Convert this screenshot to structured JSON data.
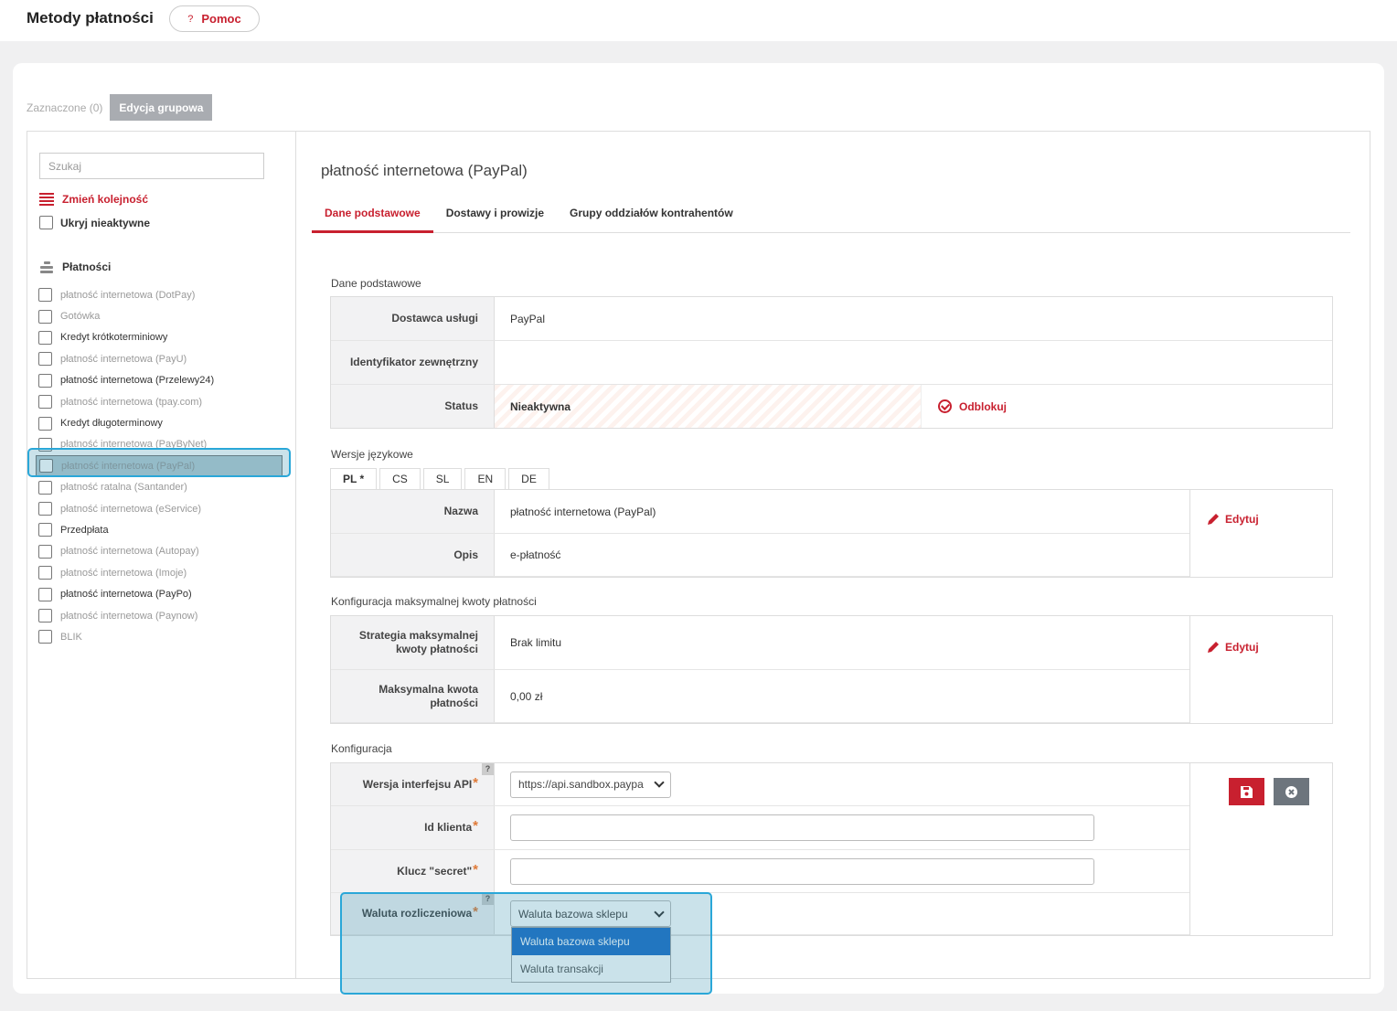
{
  "header": {
    "title": "Metody płatności",
    "help_label": "Pomoc",
    "help_icon": "?"
  },
  "bulk": {
    "selected_count": "Zaznaczone (0)",
    "group_edit_label": "Edycja grupowa"
  },
  "sidebar": {
    "search_placeholder": "Szukaj",
    "reorder_label": "Zmień kolejność",
    "hide_inactive_label": "Ukryj nieaktywne",
    "category_label": "Płatności",
    "items": [
      {
        "label": "płatność internetowa (DotPay)",
        "active": false
      },
      {
        "label": "Gotówka",
        "active": false
      },
      {
        "label": "Kredyt krótkoterminiowy",
        "active": true
      },
      {
        "label": "płatność internetowa (PayU)",
        "active": false
      },
      {
        "label": "płatność internetowa (Przelewy24)",
        "active": true
      },
      {
        "label": "płatność internetowa (tpay.com)",
        "active": false
      },
      {
        "label": "Kredyt długoterminowy",
        "active": true
      },
      {
        "label": "płatność internetowa (PayByNet)",
        "active": false
      },
      {
        "label": "płatność internetowa (PayPal)",
        "active": false,
        "selected": true
      },
      {
        "label": "płatność ratalna (Santander)",
        "active": false
      },
      {
        "label": "płatność internetowa (eService)",
        "active": false
      },
      {
        "label": "Przedpłata",
        "active": true
      },
      {
        "label": "płatność internetowa (Autopay)",
        "active": false
      },
      {
        "label": "płatność internetowa (Imoje)",
        "active": false
      },
      {
        "label": "płatność internetowa (PayPo)",
        "active": true
      },
      {
        "label": "płatność internetowa (Paynow)",
        "active": false
      },
      {
        "label": "BLIK",
        "active": false
      }
    ]
  },
  "detail": {
    "title": "płatność internetowa (PayPal)",
    "tabs": [
      "Dane podstawowe",
      "Dostawy i prowizje",
      "Grupy oddziałów kontrahentów"
    ],
    "basic": {
      "section": "Dane podstawowe",
      "provider_label": "Dostawca usługi",
      "provider_value": "PayPal",
      "external_id_label": "Identyfikator zewnętrzny",
      "external_id_value": "",
      "status_label": "Status",
      "status_value": "Nieaktywna",
      "unlock_label": "Odblokuj"
    },
    "lang": {
      "section": "Wersje językowe",
      "tabs": [
        "PL *",
        "CS",
        "SL",
        "EN",
        "DE"
      ],
      "name_label": "Nazwa",
      "name_value": "płatność internetowa (PayPal)",
      "desc_label": "Opis",
      "desc_value": "e-płatność",
      "edit_label": "Edytuj"
    },
    "limit": {
      "section": "Konfiguracja maksymalnej kwoty płatności",
      "strategy_label": "Strategia maksymalnej kwoty płatności",
      "strategy_value": "Brak limitu",
      "max_label": "Maksymalna kwota płatności",
      "max_value": "0,00 zł",
      "edit_label": "Edytuj"
    },
    "config": {
      "section": "Konfiguracja",
      "api_label": "Wersja interfejsu API",
      "api_value": "https://api.sandbox.paypa",
      "client_label": "Id klienta",
      "client_value": "",
      "secret_label": "Klucz \"secret\"",
      "secret_value": "",
      "currency_label": "Waluta rozliczeniowa",
      "currency_value": "Waluta bazowa sklepu",
      "currency_options": [
        "Waluta bazowa sklepu",
        "Waluta transakcji"
      ],
      "required_mark": "*",
      "help_mark": "?"
    }
  },
  "colors": {
    "accent": "#c8202f",
    "highlight": "#2aa7d8",
    "selected_option": "#1f6fc7"
  }
}
